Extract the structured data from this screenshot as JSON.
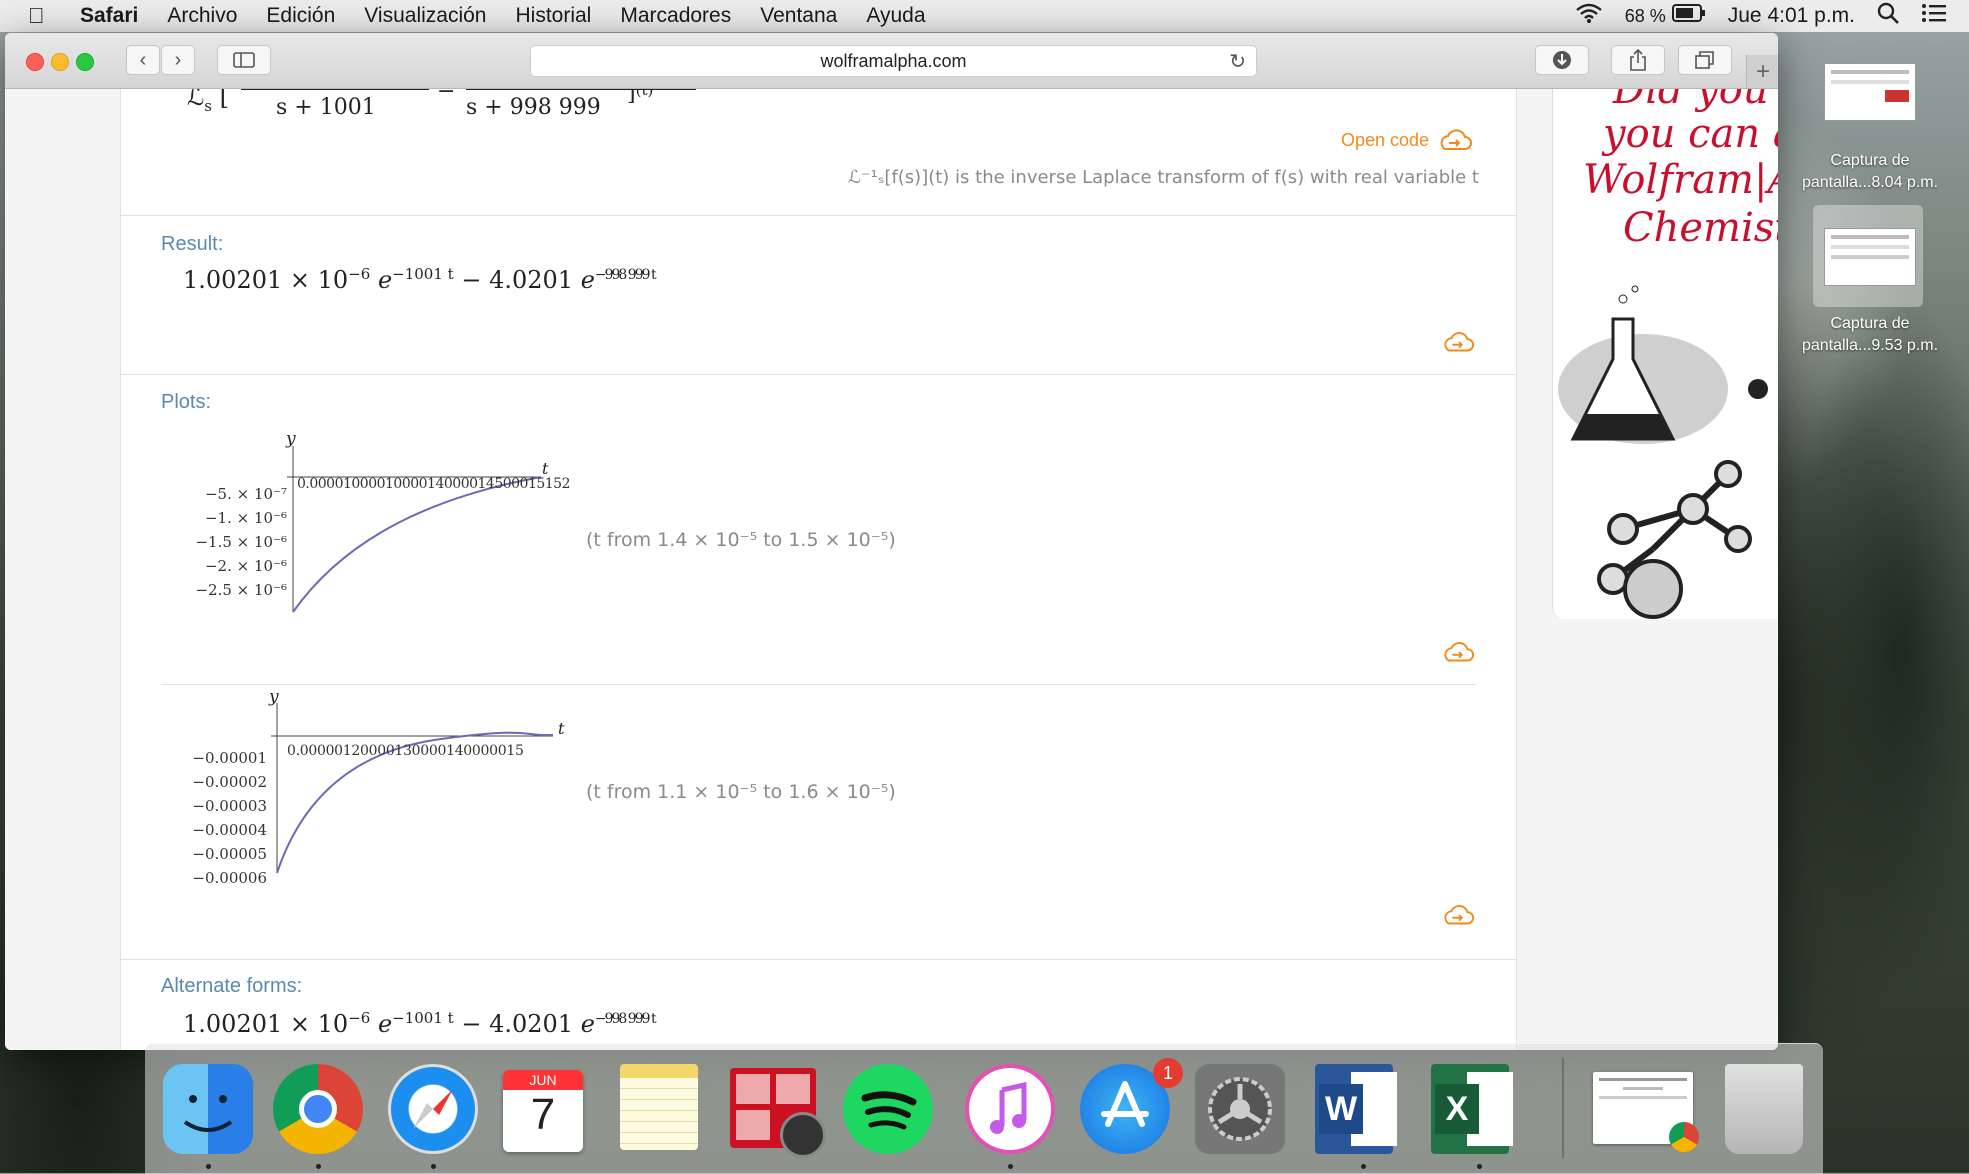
{
  "menubar": {
    "app": "Safari",
    "menus": [
      "Archivo",
      "Edición",
      "Visualización",
      "Historial",
      "Marcadores",
      "Ventana",
      "Ayuda"
    ],
    "battery": "68 %",
    "clock": "Jue 4:01 p.m."
  },
  "browser": {
    "url": "wolframalpha.com"
  },
  "page": {
    "input_denominators": [
      "s + 1001",
      "s + 998 999"
    ],
    "input_tail": "(t)",
    "open_code": "Open code",
    "note": "ℒ⁻¹ₛ[f(s)](t) is the inverse Laplace transform of f(s) with real variable t",
    "result_title": "Result:",
    "result": {
      "coef1": "1.00201",
      "times1": "× 10",
      "exp1": "−6",
      "e1": "e",
      "e1_exp": "−1001 t",
      "minus": "− 4.0201",
      "e2": "e",
      "e2_exp": "−998 999 t"
    },
    "plots_title": "Plots:",
    "plot1": {
      "y_label": "y",
      "t_label": "t",
      "x_tick_text": "0.0000100001000014000014500015152",
      "y_ticks": [
        "−5. × 10⁻⁷",
        "−1. × 10⁻⁶",
        "−1.5 × 10⁻⁶",
        "−2. × 10⁻⁶",
        "−2.5 × 10⁻⁶"
      ],
      "range": "(t from 1.4 × 10⁻⁵ to 1.5 × 10⁻⁵)"
    },
    "plot2": {
      "y_label": "y",
      "t_label": "t",
      "x_tick_text": "0.00000120000130000140000015",
      "y_ticks": [
        "−0.00001",
        "−0.00002",
        "−0.00003",
        "−0.00004",
        "−0.00005",
        "−0.00006"
      ],
      "range": "(t from 1.1 × 10⁻⁵ to 1.6 × 10⁻⁵)"
    },
    "alternate_title": "Alternate forms:",
    "alternate": {
      "coef1": "1.00201",
      "times1": "× 10",
      "exp1": "−6",
      "e1": "e",
      "e1_exp": "−1001 t",
      "minus": "− 4.0201",
      "e2": "e",
      "e2_exp": "−998 999 t"
    }
  },
  "ad": {
    "lines": [
      "Did you k",
      "you can als",
      "Wolfram|Alp",
      "Chemistry"
    ]
  },
  "desktop": {
    "screenshots": [
      {
        "label_line1": "Captura de",
        "label_line2": "pantalla...8.04 p.m."
      },
      {
        "label_line1": "Captura de",
        "label_line2": "pantalla...9.53 p.m."
      }
    ]
  },
  "dock": {
    "calendar_month": "JUN",
    "calendar_day": "7",
    "appstore_badge": "1",
    "word_letter": "W",
    "excel_letter": "X",
    "items": [
      "finder",
      "chrome",
      "safari",
      "calendar",
      "notes",
      "photo-booth",
      "spotify",
      "itunes",
      "app-store",
      "system-preferences",
      "word",
      "excel",
      "document",
      "trash"
    ]
  }
}
